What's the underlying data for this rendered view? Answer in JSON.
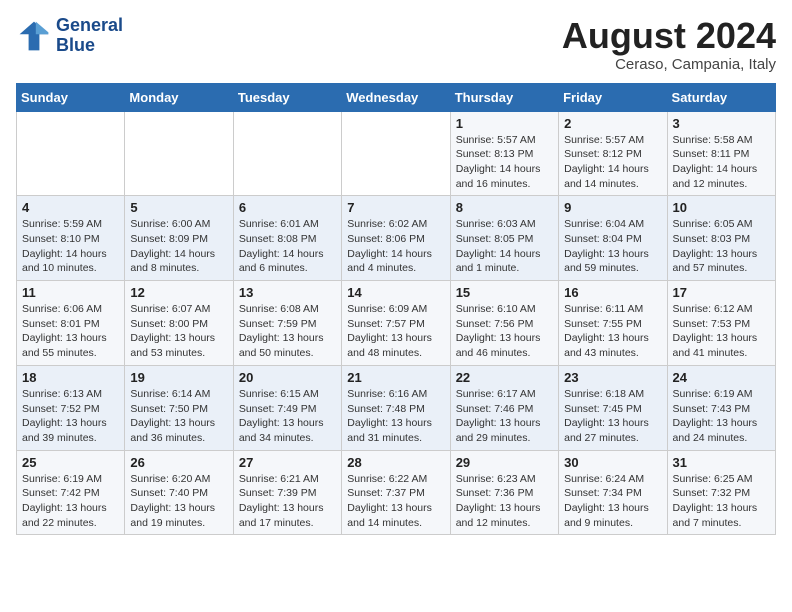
{
  "header": {
    "logo_line1": "General",
    "logo_line2": "Blue",
    "month": "August 2024",
    "location": "Ceraso, Campania, Italy"
  },
  "weekdays": [
    "Sunday",
    "Monday",
    "Tuesday",
    "Wednesday",
    "Thursday",
    "Friday",
    "Saturday"
  ],
  "weeks": [
    [
      {
        "day": "",
        "info": ""
      },
      {
        "day": "",
        "info": ""
      },
      {
        "day": "",
        "info": ""
      },
      {
        "day": "",
        "info": ""
      },
      {
        "day": "1",
        "info": "Sunrise: 5:57 AM\nSunset: 8:13 PM\nDaylight: 14 hours\nand 16 minutes."
      },
      {
        "day": "2",
        "info": "Sunrise: 5:57 AM\nSunset: 8:12 PM\nDaylight: 14 hours\nand 14 minutes."
      },
      {
        "day": "3",
        "info": "Sunrise: 5:58 AM\nSunset: 8:11 PM\nDaylight: 14 hours\nand 12 minutes."
      }
    ],
    [
      {
        "day": "4",
        "info": "Sunrise: 5:59 AM\nSunset: 8:10 PM\nDaylight: 14 hours\nand 10 minutes."
      },
      {
        "day": "5",
        "info": "Sunrise: 6:00 AM\nSunset: 8:09 PM\nDaylight: 14 hours\nand 8 minutes."
      },
      {
        "day": "6",
        "info": "Sunrise: 6:01 AM\nSunset: 8:08 PM\nDaylight: 14 hours\nand 6 minutes."
      },
      {
        "day": "7",
        "info": "Sunrise: 6:02 AM\nSunset: 8:06 PM\nDaylight: 14 hours\nand 4 minutes."
      },
      {
        "day": "8",
        "info": "Sunrise: 6:03 AM\nSunset: 8:05 PM\nDaylight: 14 hours\nand 1 minute."
      },
      {
        "day": "9",
        "info": "Sunrise: 6:04 AM\nSunset: 8:04 PM\nDaylight: 13 hours\nand 59 minutes."
      },
      {
        "day": "10",
        "info": "Sunrise: 6:05 AM\nSunset: 8:03 PM\nDaylight: 13 hours\nand 57 minutes."
      }
    ],
    [
      {
        "day": "11",
        "info": "Sunrise: 6:06 AM\nSunset: 8:01 PM\nDaylight: 13 hours\nand 55 minutes."
      },
      {
        "day": "12",
        "info": "Sunrise: 6:07 AM\nSunset: 8:00 PM\nDaylight: 13 hours\nand 53 minutes."
      },
      {
        "day": "13",
        "info": "Sunrise: 6:08 AM\nSunset: 7:59 PM\nDaylight: 13 hours\nand 50 minutes."
      },
      {
        "day": "14",
        "info": "Sunrise: 6:09 AM\nSunset: 7:57 PM\nDaylight: 13 hours\nand 48 minutes."
      },
      {
        "day": "15",
        "info": "Sunrise: 6:10 AM\nSunset: 7:56 PM\nDaylight: 13 hours\nand 46 minutes."
      },
      {
        "day": "16",
        "info": "Sunrise: 6:11 AM\nSunset: 7:55 PM\nDaylight: 13 hours\nand 43 minutes."
      },
      {
        "day": "17",
        "info": "Sunrise: 6:12 AM\nSunset: 7:53 PM\nDaylight: 13 hours\nand 41 minutes."
      }
    ],
    [
      {
        "day": "18",
        "info": "Sunrise: 6:13 AM\nSunset: 7:52 PM\nDaylight: 13 hours\nand 39 minutes."
      },
      {
        "day": "19",
        "info": "Sunrise: 6:14 AM\nSunset: 7:50 PM\nDaylight: 13 hours\nand 36 minutes."
      },
      {
        "day": "20",
        "info": "Sunrise: 6:15 AM\nSunset: 7:49 PM\nDaylight: 13 hours\nand 34 minutes."
      },
      {
        "day": "21",
        "info": "Sunrise: 6:16 AM\nSunset: 7:48 PM\nDaylight: 13 hours\nand 31 minutes."
      },
      {
        "day": "22",
        "info": "Sunrise: 6:17 AM\nSunset: 7:46 PM\nDaylight: 13 hours\nand 29 minutes."
      },
      {
        "day": "23",
        "info": "Sunrise: 6:18 AM\nSunset: 7:45 PM\nDaylight: 13 hours\nand 27 minutes."
      },
      {
        "day": "24",
        "info": "Sunrise: 6:19 AM\nSunset: 7:43 PM\nDaylight: 13 hours\nand 24 minutes."
      }
    ],
    [
      {
        "day": "25",
        "info": "Sunrise: 6:19 AM\nSunset: 7:42 PM\nDaylight: 13 hours\nand 22 minutes."
      },
      {
        "day": "26",
        "info": "Sunrise: 6:20 AM\nSunset: 7:40 PM\nDaylight: 13 hours\nand 19 minutes."
      },
      {
        "day": "27",
        "info": "Sunrise: 6:21 AM\nSunset: 7:39 PM\nDaylight: 13 hours\nand 17 minutes."
      },
      {
        "day": "28",
        "info": "Sunrise: 6:22 AM\nSunset: 7:37 PM\nDaylight: 13 hours\nand 14 minutes."
      },
      {
        "day": "29",
        "info": "Sunrise: 6:23 AM\nSunset: 7:36 PM\nDaylight: 13 hours\nand 12 minutes."
      },
      {
        "day": "30",
        "info": "Sunrise: 6:24 AM\nSunset: 7:34 PM\nDaylight: 13 hours\nand 9 minutes."
      },
      {
        "day": "31",
        "info": "Sunrise: 6:25 AM\nSunset: 7:32 PM\nDaylight: 13 hours\nand 7 minutes."
      }
    ]
  ]
}
